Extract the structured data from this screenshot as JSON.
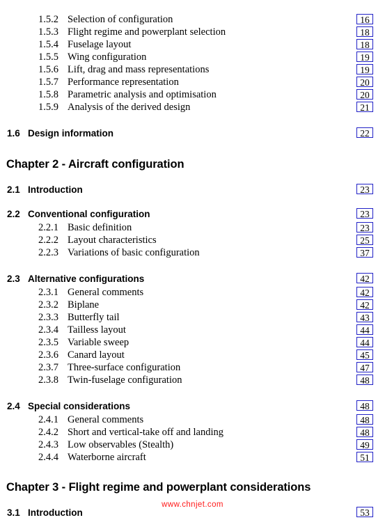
{
  "document": {
    "type": "table-of-contents",
    "watermark": "www.chnjet.com",
    "watermark_color": "#ff1a1a",
    "page_box_border_color": "#2121c6",
    "text_color": "#000000",
    "background_color": "#ffffff"
  },
  "entries": [
    {
      "kind": "sub",
      "number": "1.5.2",
      "title": "Selection of configuration",
      "page": "16"
    },
    {
      "kind": "sub",
      "number": "1.5.3",
      "title": " Flight regime and powerplant selection",
      "page": "18"
    },
    {
      "kind": "sub",
      "number": "1.5.4",
      "title": "Fuselage layout",
      "page": "18"
    },
    {
      "kind": "sub",
      "number": "1.5.5",
      "title": "Wing configuration",
      "page": "19"
    },
    {
      "kind": "sub",
      "number": "1.5.6",
      "title": "Lift, drag and mass representations",
      "page": "19"
    },
    {
      "kind": "sub",
      "number": "1.5.7",
      "title": "Performance representation",
      "page": "20"
    },
    {
      "kind": "sub",
      "number": "1.5.8",
      "title": "Parametric analysis and optimisation",
      "page": "20"
    },
    {
      "kind": "sub",
      "number": "1.5.9",
      "title": "Analysis of the derived design",
      "page": "21"
    },
    {
      "kind": "sec",
      "number": "1.6",
      "title": "Design information",
      "page": "22"
    },
    {
      "kind": "chapter",
      "number": "",
      "title": "Chapter 2 - Aircraft configuration",
      "page": ""
    },
    {
      "kind": "sec",
      "number": "2.1",
      "title": "Introduction",
      "page": "23"
    },
    {
      "kind": "sec",
      "number": "2.2",
      "title": "Conventional configuration",
      "page": "23"
    },
    {
      "kind": "sub",
      "number": "2.2.1",
      "title": "Basic definition",
      "page": "23"
    },
    {
      "kind": "sub",
      "number": "2.2.2",
      "title": "Layout characteristics",
      "page": "25"
    },
    {
      "kind": "sub",
      "number": "2.2.3",
      "title": "Variations of basic configuration",
      "page": "37"
    },
    {
      "kind": "sec",
      "number": "2.3",
      "title": "Alternative configurations",
      "page": "42"
    },
    {
      "kind": "sub",
      "number": "2.3.1",
      "title": "General comments",
      "page": "42"
    },
    {
      "kind": "sub",
      "number": "2.3.2",
      "title": "Biplane",
      "page": "42"
    },
    {
      "kind": "sub",
      "number": "2.3.3",
      "title": "Butterfly tail",
      "page": "43"
    },
    {
      "kind": "sub",
      "number": "2.3.4",
      "title": "Tailless layout",
      "page": "44"
    },
    {
      "kind": "sub",
      "number": "2.3.5",
      "title": "Variable sweep",
      "page": "44"
    },
    {
      "kind": "sub",
      "number": "2.3.6",
      "title": "Canard layout",
      "page": "45"
    },
    {
      "kind": "sub",
      "number": "2.3.7",
      "title": "Three-surface configuration",
      "page": "47"
    },
    {
      "kind": "sub",
      "number": "2.3.8",
      "title": "Twin-fuselage configuration",
      "page": "48"
    },
    {
      "kind": "sec",
      "number": "2.4",
      "title": "Special considerations",
      "page": "48"
    },
    {
      "kind": "sub",
      "number": "2.4.1",
      "title": "General comments",
      "page": "48"
    },
    {
      "kind": "sub",
      "number": "2.4.2",
      "title": "Short and vertical-take off and landing",
      "page": "48"
    },
    {
      "kind": "sub",
      "number": "2.4.3",
      "title": "Low observables (Stealth)",
      "page": "49"
    },
    {
      "kind": "sub",
      "number": "2.4.4",
      "title": "Waterborne aircraft",
      "page": "51"
    },
    {
      "kind": "chapter",
      "number": "",
      "title": "Chapter 3 - Flight regime and powerplant considerations",
      "page": ""
    },
    {
      "kind": "sec",
      "number": "3.1",
      "title": "Introduction",
      "page": "53"
    }
  ]
}
